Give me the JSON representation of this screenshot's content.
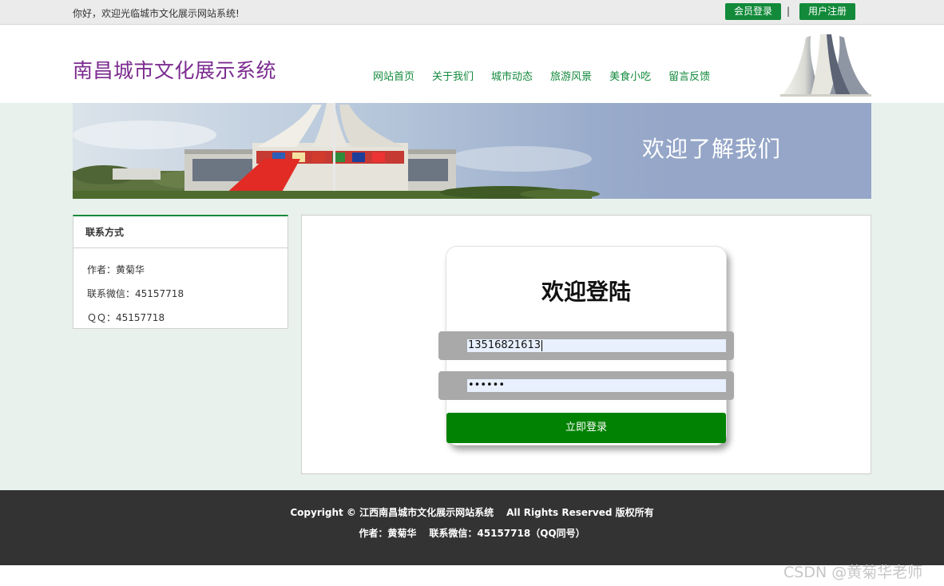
{
  "topbar": {
    "greeting": "你好，欢迎光临城市文化展示网站系统!",
    "login_label": "会员登录",
    "separator": "|",
    "register_label": "用户注册"
  },
  "header": {
    "site_title": "南昌城市文化展示系统",
    "nav": [
      "网站首页",
      "关于我们",
      "城市动态",
      "旅游风景",
      "美食小吃",
      "留言反馈"
    ]
  },
  "banner": {
    "text": "欢迎了解我们"
  },
  "sidebar": {
    "title": "联系方式",
    "items": [
      "作者：黄菊华",
      "联系微信：45157718",
      "ＱＱ：45157718"
    ]
  },
  "login": {
    "heading": "欢迎登陆",
    "username_value": "13516821613",
    "password_value": "••••••",
    "submit_label": "立即登录"
  },
  "footer": {
    "copyright": "Copyright © 江西南昌城市文化展示网站系统",
    "rights": "All Rights Reserved 版权所有",
    "author": "作者：黄菊华",
    "contact": "联系微信：45157718（QQ同号）"
  },
  "watermark": "CSDN @黄菊华老师",
  "colors": {
    "accent_green": "#128a3a",
    "title_purple": "#7b2b8f",
    "button_green": "#028203",
    "footer_bg": "#333333"
  }
}
